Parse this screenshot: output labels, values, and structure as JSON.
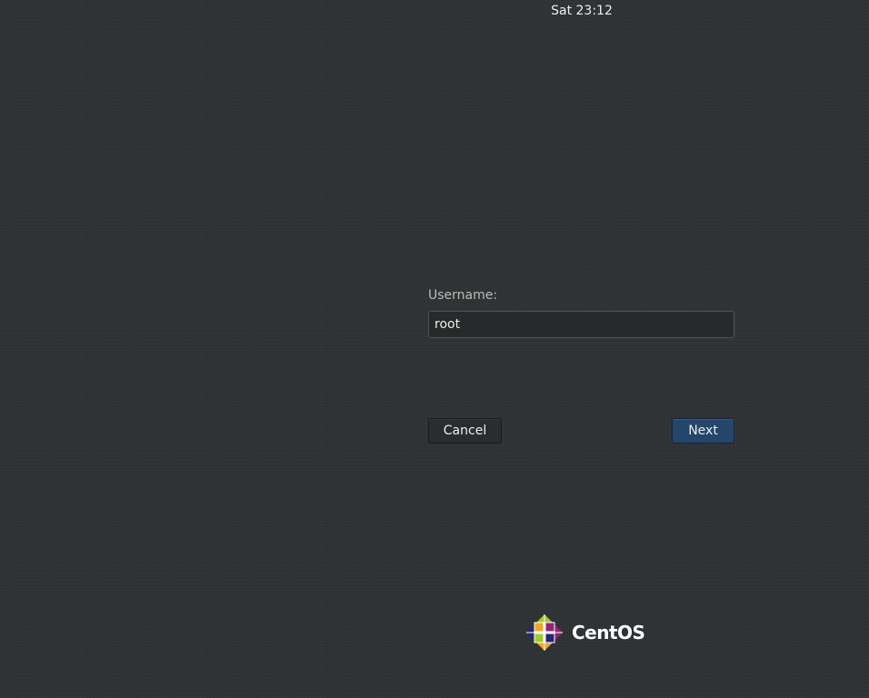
{
  "top_bar": {
    "clock": "Sat 23:12"
  },
  "login": {
    "username_label": "Username:",
    "username_value": "root",
    "cancel_label": "Cancel",
    "next_label": "Next"
  },
  "branding": {
    "logo_icon": "centos-logo-icon",
    "logo_text": "CentOS",
    "colors": {
      "background": "#2f3234",
      "next_button": "#24466b",
      "logo_yellow": "#efa724",
      "logo_green": "#9ccd2a",
      "logo_purple": "#932279",
      "logo_blue": "#262577"
    }
  }
}
